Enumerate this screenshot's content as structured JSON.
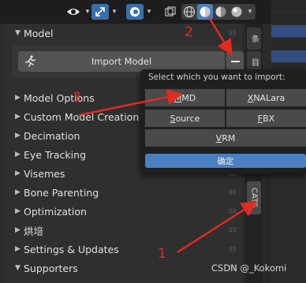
{
  "header": {
    "icons": [
      "eye-icon",
      "gizmo-icon",
      "overlay-icon",
      "xray-icon"
    ],
    "shading": [
      "wireframe",
      "solid",
      "material",
      "rendered"
    ],
    "active_shading": "solid"
  },
  "panel": {
    "title": "Model",
    "import_label": "Import Model",
    "sections": [
      "Model Options",
      "Custom Model Creation",
      "Decimation",
      "Eye Tracking",
      "Visemes",
      "Bone Parenting",
      "Optimization",
      "烘培",
      "Settings & Updates",
      "Supporters"
    ]
  },
  "tabs": {
    "items": [
      "条",
      "目",
      "CATS"
    ],
    "active": "CATS"
  },
  "popup": {
    "title": "Select which you want to import:",
    "options": [
      {
        "pre": "",
        "ul": "M",
        "post": "MD"
      },
      {
        "pre": "",
        "ul": "X",
        "post": "NALara"
      },
      {
        "pre": "",
        "ul": "S",
        "post": "ource"
      },
      {
        "pre": "",
        "ul": "F",
        "post": "BX"
      },
      {
        "pre": "",
        "ul": "V",
        "post": "RM"
      }
    ],
    "confirm": "确定"
  },
  "annotations": {
    "numbers": [
      "1",
      "2",
      "3"
    ],
    "color": "#e02b20"
  },
  "watermark": "CSDN @_Kokomi"
}
